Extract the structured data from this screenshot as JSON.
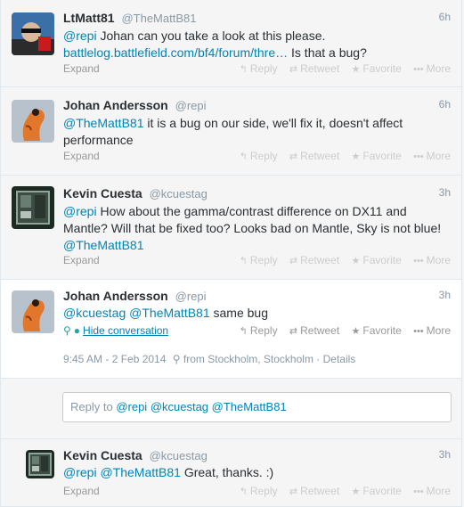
{
  "tweets": [
    {
      "fullname": "LtMatt81",
      "username": "@TheMattB81",
      "time": "6h",
      "text_parts": [
        "@repi",
        " Johan can you take a look at this please. ",
        "battlelog.battlefield.com/bf4/forum/thre…",
        " Is that a bug?"
      ],
      "expand": "Expand"
    },
    {
      "fullname": "Johan Andersson",
      "username": "@repi",
      "time": "6h",
      "text_parts": [
        "@TheMattB81",
        " it is a bug on our side, we'll fix it, doesn't affect performance"
      ],
      "expand": "Expand"
    },
    {
      "fullname": "Kevin Cuesta",
      "username": "@kcuestag",
      "time": "3h",
      "text_parts": [
        "@repi",
        " How about the gamma/contrast difference on DX11 and Mantle? Will that be fixed too? Looks bad on Mantle, Sky is not blue! ",
        "@TheMattB81"
      ],
      "expand": "Expand"
    },
    {
      "fullname": "Johan Andersson",
      "username": "@repi",
      "time": "3h",
      "text_parts": [
        "@kcuestag",
        " ",
        "@TheMattB81",
        " same bug"
      ],
      "hide_conversation": "Hide conversation",
      "meta": {
        "datetime": "9:45 AM - 2 Feb 2014",
        "location": "from Stockholm, Stockholm",
        "details": "Details"
      }
    },
    {
      "fullname": "Kevin Cuesta",
      "username": "@kcuestag",
      "time": "3h",
      "text_parts": [
        "@repi",
        " ",
        "@TheMattB81",
        " Great, thanks. :)"
      ],
      "expand": "Expand"
    }
  ],
  "actions": {
    "reply": "Reply",
    "retweet": "Retweet",
    "favorite": "Favorite",
    "more": "More"
  },
  "reply_box": {
    "prefix": "Reply to ",
    "mentions": [
      "@repi",
      "@kcuestag",
      "@TheMattB81"
    ]
  },
  "icons": {
    "reply": "reply-arrow-icon",
    "retweet": "retweet-icon",
    "favorite": "star-icon",
    "more": "ellipsis-icon",
    "location": "map-pin-icon",
    "conversation": "speech-bubble-icon"
  },
  "colors": {
    "link": "#0084b4",
    "muted": "#8899a6",
    "highlight_bg": "#ffffff",
    "page_bg": "#f5f5f5"
  }
}
